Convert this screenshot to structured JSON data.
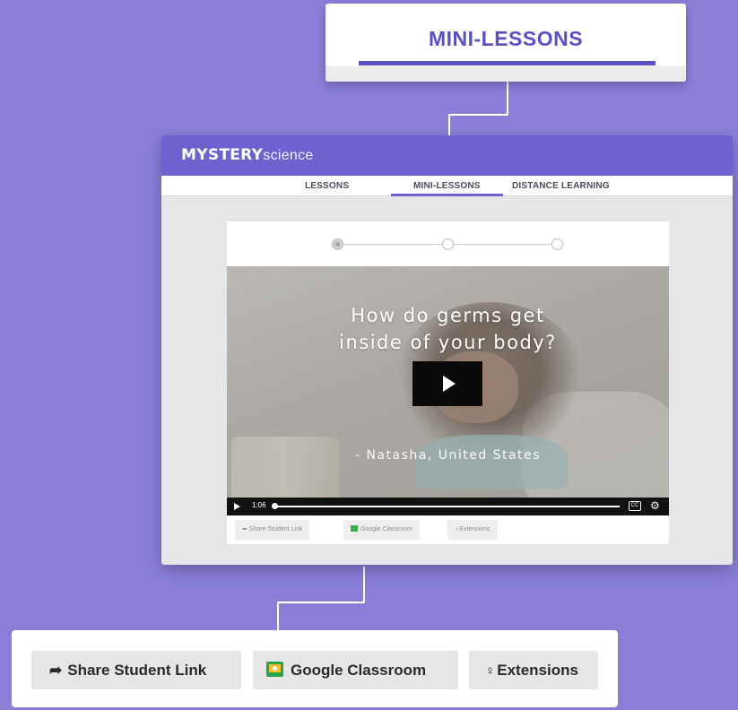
{
  "callout_top": {
    "title": "MINI-LESSONS"
  },
  "browser": {
    "brand": {
      "bold": "MYSTERY",
      "light": "science"
    },
    "nav": [
      {
        "label": "LESSONS"
      },
      {
        "label": "MINI-LESSONS",
        "active": true
      },
      {
        "label": "DISTANCE LEARNING"
      }
    ],
    "progress_steps": 3,
    "progress_current": 1,
    "video": {
      "title_line1": "How do germs get",
      "title_line2": "inside of your body?",
      "credit": "- Natasha, United States",
      "time": "1:06",
      "cc_label": "CC"
    },
    "card_actions": {
      "share": "Share Student Link",
      "classroom": "Google Classroom",
      "extensions": "Extensions"
    }
  },
  "callout_bottom": {
    "share": "Share Student Link",
    "classroom": "Google Classroom",
    "extensions": "Extensions"
  },
  "colors": {
    "background": "#8a7ed8",
    "brand_purple": "#6e62cf",
    "accent_text": "#5a4fc4",
    "google_green": "#2ba149",
    "google_yellow": "#f6c026"
  },
  "icons": {
    "share": "share-arrow-icon",
    "classroom": "google-classroom-icon",
    "extensions": "lightbulb-icon",
    "play": "play-icon",
    "captions": "closed-captions-icon",
    "settings": "gear-icon"
  }
}
